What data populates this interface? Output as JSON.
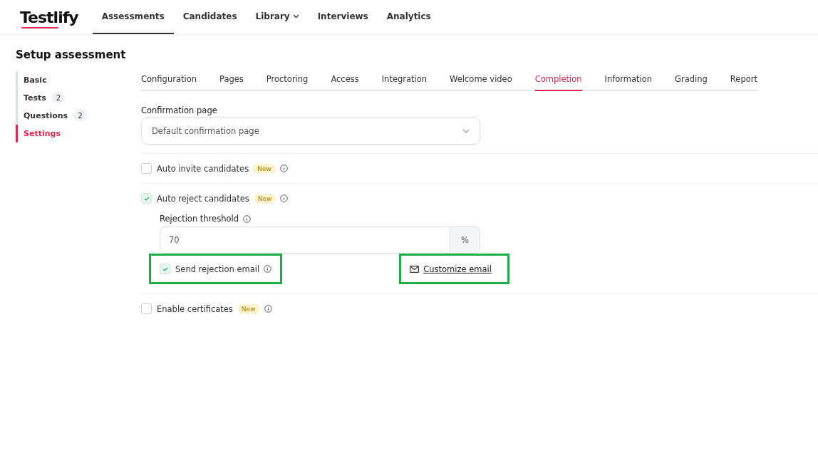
{
  "logo": {
    "text": "Testlify"
  },
  "nav": [
    {
      "label": "Assessments",
      "selected": true,
      "dropdown": false
    },
    {
      "label": "Candidates",
      "selected": false,
      "dropdown": false
    },
    {
      "label": "Library",
      "selected": false,
      "dropdown": true
    },
    {
      "label": "Interviews",
      "selected": false,
      "dropdown": false
    },
    {
      "label": "Analytics",
      "selected": false,
      "dropdown": false
    }
  ],
  "page_title": "Setup assessment",
  "sidebar": {
    "items": [
      {
        "label": "Basic",
        "selected": false
      },
      {
        "label": "Tests",
        "count": "2",
        "selected": false
      },
      {
        "label": "Questions",
        "count": "2",
        "selected": false
      },
      {
        "label": "Settings",
        "selected": true
      }
    ]
  },
  "tabs": [
    {
      "label": "Configuration",
      "selected": false
    },
    {
      "label": "Pages",
      "selected": false
    },
    {
      "label": "Proctoring",
      "selected": false
    },
    {
      "label": "Access",
      "selected": false
    },
    {
      "label": "Integration",
      "selected": false
    },
    {
      "label": "Welcome video",
      "selected": false
    },
    {
      "label": "Completion",
      "selected": true
    },
    {
      "label": "Information",
      "selected": false
    },
    {
      "label": "Grading",
      "selected": false
    },
    {
      "label": "Report",
      "selected": false
    }
  ],
  "confirmation_page": {
    "label": "Confirmation page",
    "value": "Default confirmation page"
  },
  "options": [
    {
      "label": "Auto invite candidates",
      "badge": "New",
      "checked": false
    },
    {
      "label": "Auto reject candidates",
      "badge": "New",
      "checked": true,
      "threshold": {
        "label": "Rejection threshold",
        "value": "70",
        "unit": "%"
      },
      "send_email": {
        "label": "Send rejection email",
        "checked": true,
        "highlighted": true
      },
      "customize": {
        "label": "Customize email",
        "highlighted": true
      }
    },
    {
      "label": "Enable certificates",
      "badge": "New",
      "checked": false
    }
  ]
}
